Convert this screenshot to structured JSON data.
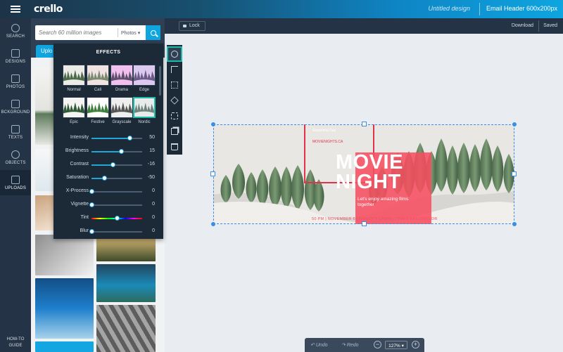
{
  "header": {
    "logo": "crello",
    "design_name": "Untitled design",
    "format": "Email Header 600x200px"
  },
  "sidebar": {
    "items": [
      {
        "label": "SEARCH",
        "icon": "search-icon"
      },
      {
        "label": "DESIGNS",
        "icon": "designs-icon"
      },
      {
        "label": "PHOTOS",
        "icon": "photos-icon"
      },
      {
        "label": "BCKGROUND",
        "icon": "background-icon"
      },
      {
        "label": "TEXTS",
        "icon": "texts-icon"
      },
      {
        "label": "OBJECTS",
        "icon": "objects-icon"
      },
      {
        "label": "UPLOADS",
        "icon": "uploads-icon"
      }
    ],
    "active": "UPLOADS",
    "howto": "HOW-TO GUIDE"
  },
  "search": {
    "placeholder": "Search 60 million images",
    "type": "Photos"
  },
  "uploads_tab": "Uplo",
  "effects": {
    "title": "EFFECTS",
    "presets": [
      "Normal",
      "Cali",
      "Drama",
      "Edge",
      "Epic",
      "Festive",
      "Grayscale",
      "Nordic"
    ],
    "selected_preset": "Nordic",
    "sliders": [
      {
        "label": "Intensity",
        "value": "50",
        "level": 0.75
      },
      {
        "label": "Brightness",
        "value": "15",
        "level": 0.58
      },
      {
        "label": "Contrast",
        "value": "-16",
        "level": 0.42
      },
      {
        "label": "Saturation",
        "value": "-50",
        "level": 0.25
      },
      {
        "label": "X-Process",
        "value": "0",
        "level": 0.0
      },
      {
        "label": "Vignette",
        "value": "0",
        "level": 0.0
      },
      {
        "label": "Tint",
        "value": "0",
        "level": 0.5
      },
      {
        "label": "Blur",
        "value": "0",
        "level": 0.0
      }
    ]
  },
  "canvas_bar": {
    "lock": "Lock",
    "download": "Download",
    "saved": "Saved"
  },
  "design": {
    "small_top": "Streaming Day",
    "site": "MOVIENIGHTS.CA",
    "title_line1": "MOVIE",
    "title_line2": "NIGHT",
    "tagline": "Let's enjoy amazing films together",
    "details": "50 PM | NOVEMBER 6 | NANCY'S CABIN | 7700 E KELLOGG DR"
  },
  "bottom_bar": {
    "undo": "Undo",
    "redo": "Redo",
    "zoom": "127%",
    "zoom_out": "−",
    "zoom_in": "+"
  },
  "colors": {
    "accent": "#0ea5e0",
    "sidebar_bg": "#243345",
    "selected_teal": "#1fb9a9",
    "design_red": "#f64e60"
  }
}
